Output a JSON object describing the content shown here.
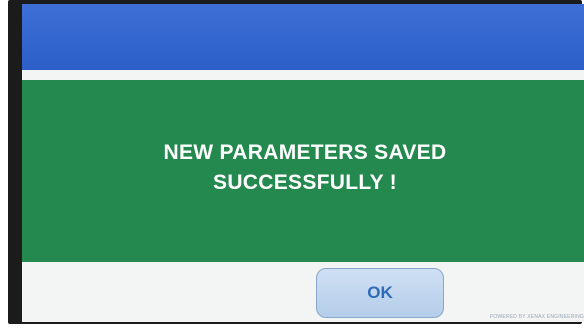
{
  "dialog": {
    "message_line1": "NEW PARAMETERS SAVED",
    "message_line2": "SUCCESSFULLY !",
    "ok_label": "OK"
  },
  "footer": {
    "powered_by": "POWERED BY XENAX ENGINEERING"
  },
  "colors": {
    "header_blue": "#3366cc",
    "message_green": "#24894f",
    "button_blue": "#c2d7ef",
    "button_text": "#2e6ab8"
  }
}
